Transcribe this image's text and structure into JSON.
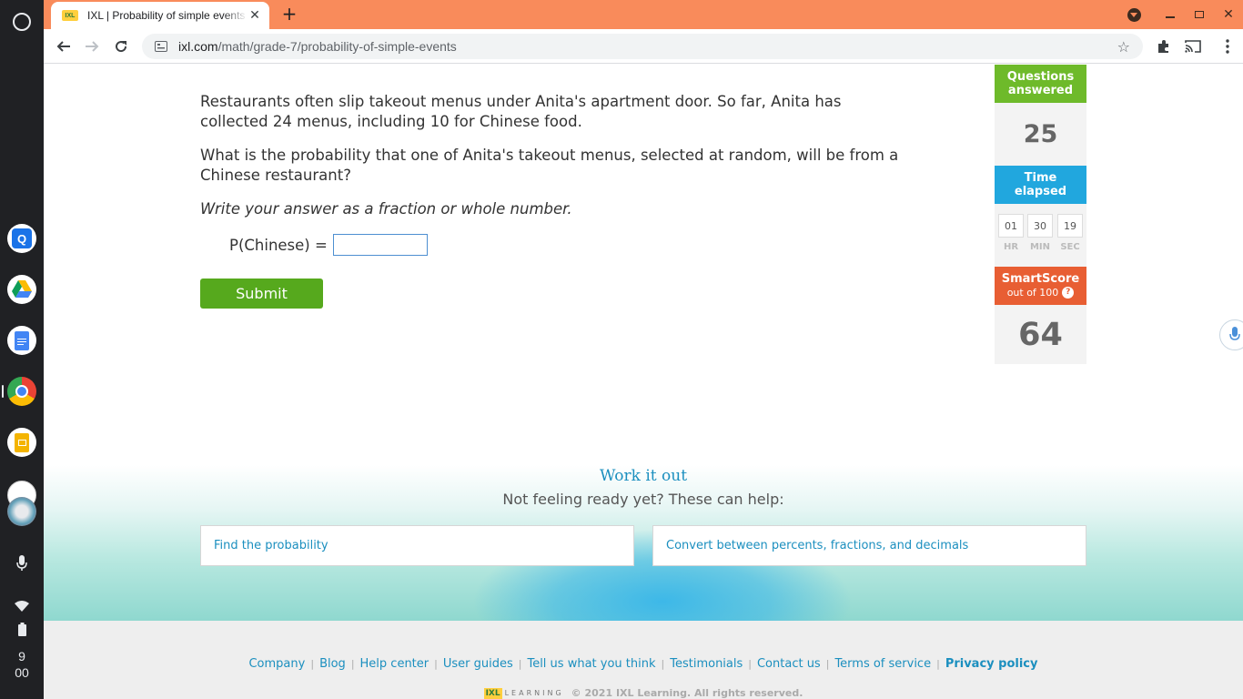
{
  "shelf": {
    "time_hour": "9",
    "time_minute": "00"
  },
  "browser": {
    "tab_title": "IXL | Probability of simple events",
    "tab_favicon": "IXL",
    "tab_close": "✕",
    "new_tab": "+",
    "url_host": "ixl.com",
    "url_path": "/math/grade-7/probability-of-simple-events"
  },
  "question": {
    "paragraph1": "Restaurants often slip takeout menus under Anita's apartment door. So far, Anita has collected 24 menus, including 10 for Chinese food.",
    "paragraph2": "What is the probability that one of Anita's takeout menus, selected at random, will be from a Chinese restaurant?",
    "instruction": "Write your answer as a fraction or whole number.",
    "answer_label": "P(Chinese) =",
    "answer_value": "",
    "submit_label": "Submit"
  },
  "stats": {
    "questions_answered_label_1": "Questions",
    "questions_answered_label_2": "answered",
    "questions_answered_value": "25",
    "time_elapsed_label_1": "Time",
    "time_elapsed_label_2": "elapsed",
    "hours": "01",
    "minutes": "30",
    "seconds": "19",
    "hr_label": "HR",
    "min_label": "MIN",
    "sec_label": "SEC",
    "smartscore_label": "SmartScore",
    "smartscore_sub": "out of 100",
    "help_glyph": "?",
    "smartscore_value": "64"
  },
  "work_it_out": {
    "title": "Work it out",
    "subtitle": "Not feeling ready yet? These can help:",
    "cards": [
      {
        "label": "Find the probability"
      },
      {
        "label": "Convert between percents, fractions, and decimals"
      }
    ]
  },
  "footer": {
    "links": [
      "Company",
      "Blog",
      "Help center",
      "User guides",
      "Tell us what you think",
      "Testimonials",
      "Contact us",
      "Terms of service"
    ],
    "privacy": "Privacy policy",
    "logo_mark": "IXL",
    "logo_word": "LEARNING",
    "copyright": "© 2021 IXL Learning. All rights reserved."
  },
  "colors": {
    "tabbar": "#f98b5b",
    "questions_green": "#6eba2a",
    "time_blue": "#21a7de",
    "smartscore_orange": "#e85e33",
    "submit_green": "#56a91d",
    "link_blue": "#1b8fbf"
  }
}
